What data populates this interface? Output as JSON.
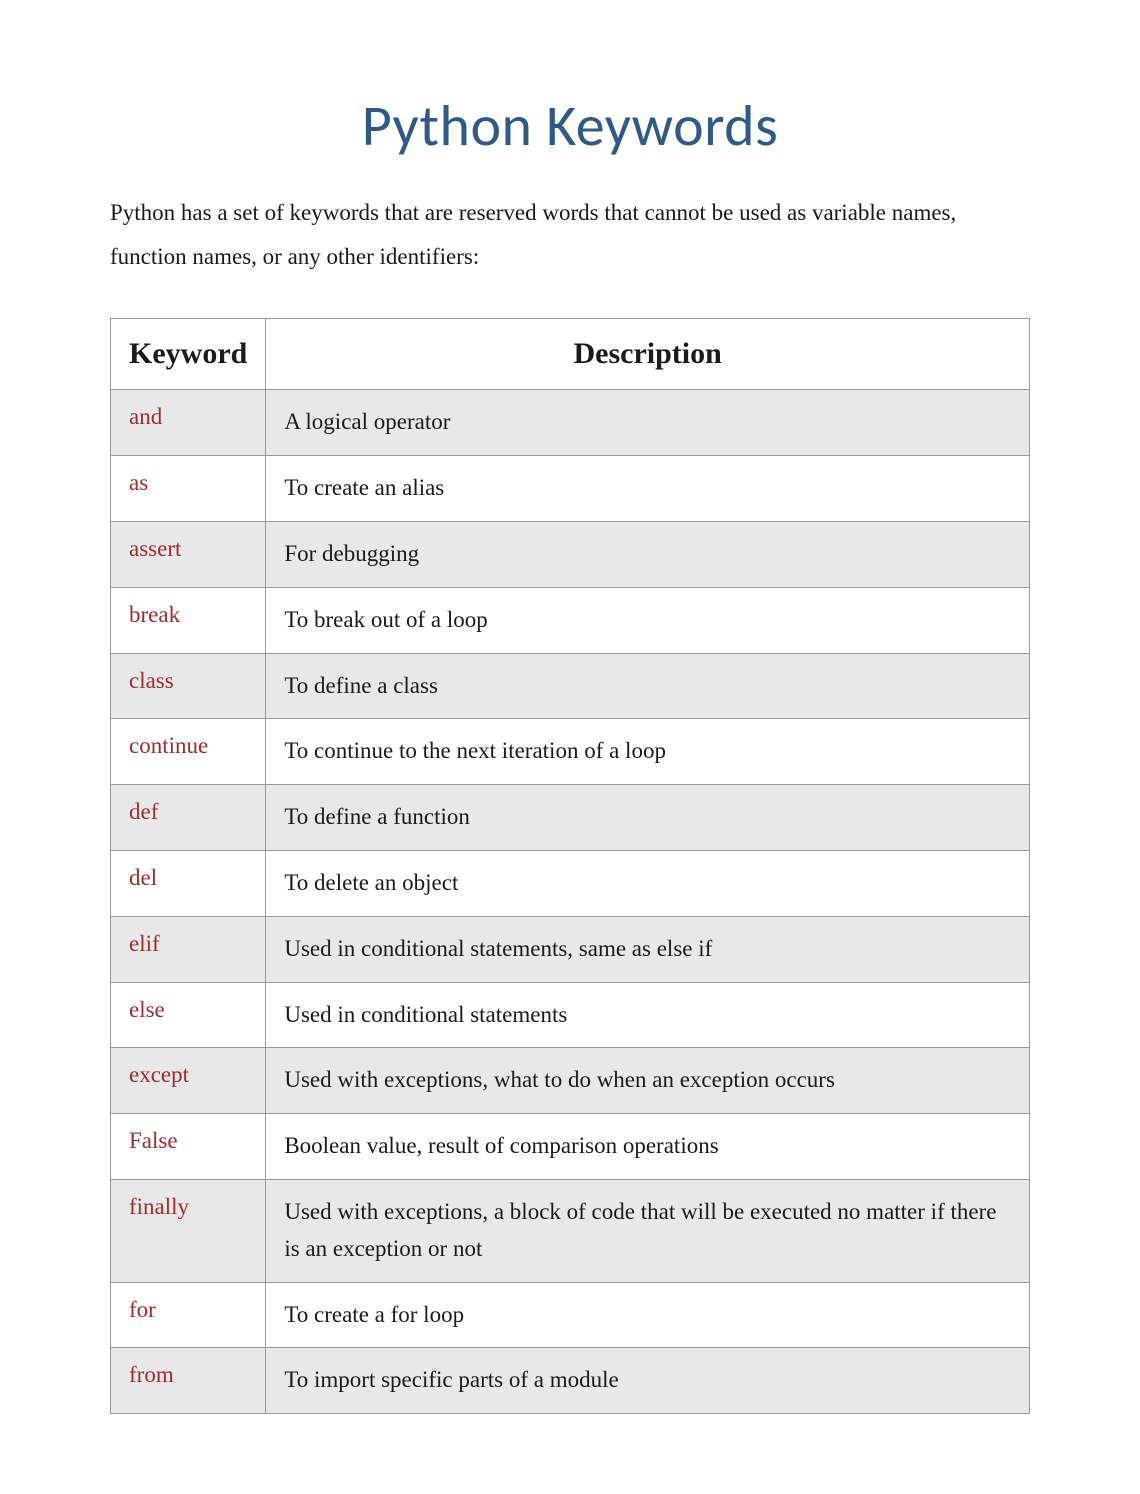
{
  "title": "Python Keywords",
  "intro": "Python has a set of keywords that are reserved words that cannot be used as variable names, function names, or any other identifiers:",
  "columns": {
    "keyword": "Keyword",
    "description": "Description"
  },
  "rows": [
    {
      "keyword": "and",
      "description": "A logical operator"
    },
    {
      "keyword": "as",
      "description": "To create an alias"
    },
    {
      "keyword": "assert",
      "description": "For debugging"
    },
    {
      "keyword": "break",
      "description": "To break out of a loop"
    },
    {
      "keyword": "class",
      "description": "To define a class"
    },
    {
      "keyword": "continue",
      "description": "To continue to the next iteration of a loop"
    },
    {
      "keyword": "def",
      "description": "To define a function"
    },
    {
      "keyword": "del",
      "description": "To delete an object"
    },
    {
      "keyword": "elif",
      "description": "Used in conditional statements, same as else if"
    },
    {
      "keyword": "else",
      "description": "Used in conditional statements"
    },
    {
      "keyword": "except",
      "description": "Used with exceptions, what to do when an exception occurs"
    },
    {
      "keyword": "False",
      "description": "Boolean value, result of comparison operations"
    },
    {
      "keyword": "finally",
      "description": "Used with exceptions, a block of code that will be executed no matter if there is an exception or not"
    },
    {
      "keyword": "for",
      "description": "To create a for loop"
    },
    {
      "keyword": "from",
      "description": "To import specific parts of a module"
    }
  ]
}
